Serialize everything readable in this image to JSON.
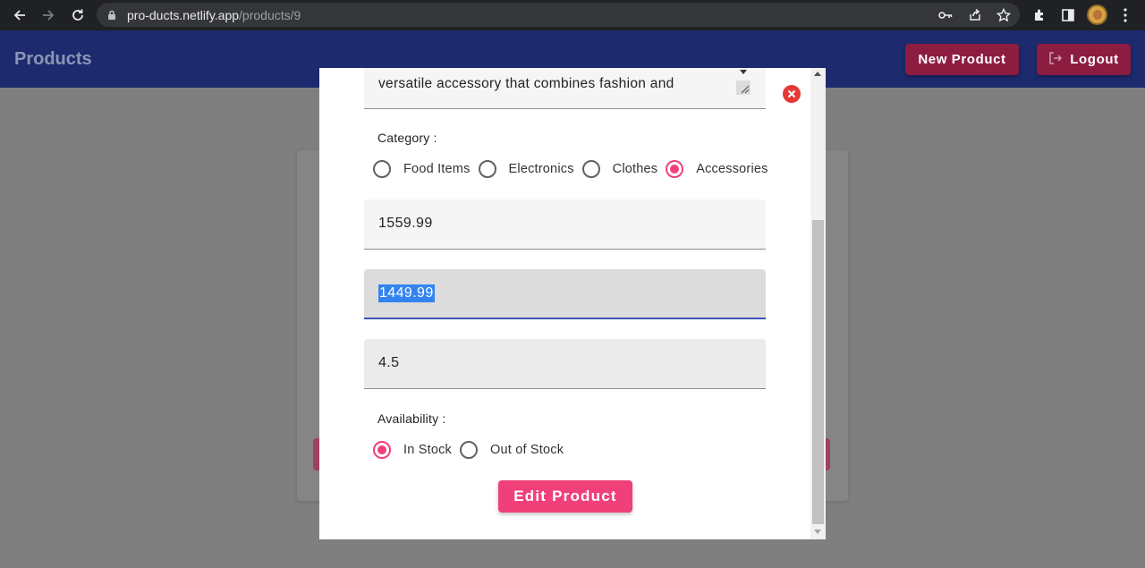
{
  "browser": {
    "url_host": "pro-ducts.netlify.app",
    "url_path": "/products/9"
  },
  "header": {
    "brand": "Products",
    "new_product_label": "New Product",
    "logout_label": "Logout"
  },
  "modal": {
    "description_visible_text": "versatile accessory that combines fashion and",
    "category_label": "Category :",
    "categories": [
      {
        "label": "Food Items",
        "checked": false
      },
      {
        "label": "Electronics",
        "checked": false
      },
      {
        "label": "Clothes",
        "checked": false
      },
      {
        "label": "Accessories",
        "checked": true
      }
    ],
    "price_value": "1559.99",
    "discount_price_value": "1449.99",
    "rating_value": "4.5",
    "availability_label": "Availability :",
    "availability": [
      {
        "label": "In Stock",
        "checked": true
      },
      {
        "label": "Out of Stock",
        "checked": false
      }
    ],
    "submit_label": "Edit Product"
  },
  "colors": {
    "appbar": "#1d2a6e",
    "header_button": "#8c1d40",
    "accent_pink": "#f0407a",
    "focus_underline": "#3f51b5",
    "close_red": "#e53935"
  }
}
